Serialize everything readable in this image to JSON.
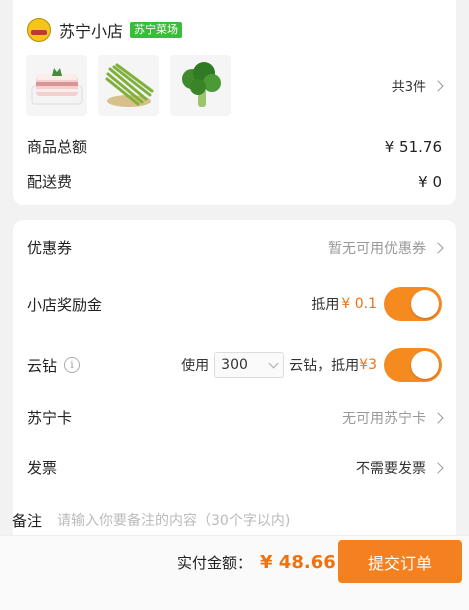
{
  "store": {
    "name": "苏宁小店",
    "tag": "苏宁菜场"
  },
  "items": {
    "count_label": "共3件",
    "thumbnails": [
      {
        "icon": "pork-belly"
      },
      {
        "icon": "green-beans"
      },
      {
        "icon": "broccoli"
      }
    ]
  },
  "summary": {
    "goods_total_label": "商品总额",
    "goods_total_value": "¥ 51.76",
    "delivery_label": "配送费",
    "delivery_value": "¥ 0"
  },
  "options": {
    "coupon_label": "优惠券",
    "coupon_value": "暂无可用优惠券",
    "reward_label": "小店奖励金",
    "reward_deduct": "抵用",
    "reward_amount": "¥ 0.1",
    "reward_toggle": true,
    "yunzuan_label": "云钻",
    "yunzuan_use": "使用",
    "yunzuan_select": "300",
    "yunzuan_unit": "云钻，抵用",
    "yunzuan_amount": "¥3",
    "yunzuan_toggle": true,
    "suning_card_label": "苏宁卡",
    "suning_card_value": "无可用苏宁卡",
    "invoice_label": "发票",
    "invoice_value": "不需要发票"
  },
  "remark": {
    "label": "备注",
    "placeholder": "请输入你要备注的内容（30个字以内)"
  },
  "footer": {
    "pay_label": "实付金额：",
    "pay_amount": "¥ 48.66",
    "submit_label": "提交订单"
  },
  "colors": {
    "accent": "#f58a1f",
    "price": "#f0720e",
    "tag": "#3bbb3b"
  }
}
